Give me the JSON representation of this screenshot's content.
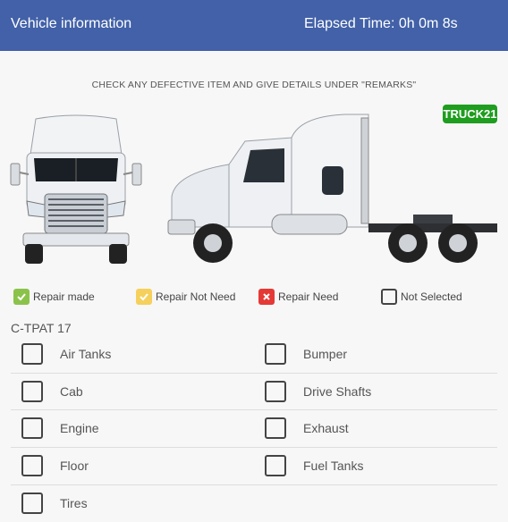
{
  "header": {
    "title": "Vehicle information",
    "elapsed": "Elapsed Time: 0h 0m 8s",
    "bg_color": "#4261a8"
  },
  "instruction": "CHECK ANY DEFECTIVE ITEM AND GIVE DETAILS UNDER \"REMARKS\"",
  "badge": {
    "text": "TRUCK21",
    "color": "#1f9d1f"
  },
  "images": {
    "front": "truck-front-icon",
    "side": "truck-side-icon"
  },
  "legend": [
    {
      "label": "Repair made",
      "icon": "check-icon",
      "color": "#8bc34a"
    },
    {
      "label": "Repair Not Need",
      "icon": "check-icon",
      "color": "#f5d05c"
    },
    {
      "label": "Repair Need",
      "icon": "x-icon",
      "color": "#e53935"
    },
    {
      "label": "Not Selected",
      "icon": "empty-box-icon",
      "color": "#444444"
    }
  ],
  "section": {
    "title": "C-TPAT 17",
    "items": [
      {
        "label": "Air Tanks"
      },
      {
        "label": "Bumper"
      },
      {
        "label": "Cab"
      },
      {
        "label": "Drive Shafts"
      },
      {
        "label": "Engine"
      },
      {
        "label": "Exhaust"
      },
      {
        "label": "Floor"
      },
      {
        "label": "Fuel Tanks"
      },
      {
        "label": "Tires"
      }
    ]
  }
}
